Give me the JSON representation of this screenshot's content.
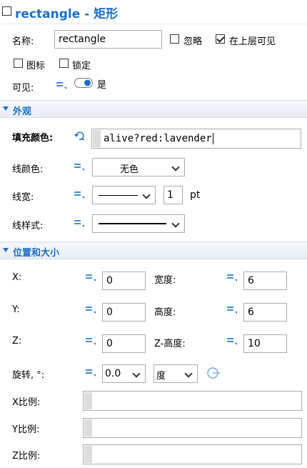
{
  "title": "rectangle - 矩形",
  "general": {
    "name_label": "名称:",
    "name_value": "rectangle",
    "ignore_label": "忽略",
    "ignore_checked": false,
    "show_on_top_label": "在上层可见",
    "show_on_top_checked": true,
    "icon_label": "图标",
    "icon_checked": false,
    "lock_label": "锁定",
    "lock_checked": false,
    "visible_label": "可见:",
    "visible_value": "是",
    "visible_on": true
  },
  "appearance": {
    "section_label": "外观",
    "fill_color_label": "填充颜色:",
    "fill_color_value": "alive?red:lavender",
    "line_color_label": "线颜色:",
    "line_color_value": "无色",
    "line_width_label": "线宽:",
    "line_width_value": "1",
    "line_width_unit": "pt",
    "line_style_label": "线样式:"
  },
  "position": {
    "section_label": "位置和大小",
    "x_label": "X:",
    "x_value": "0",
    "width_label": "宽度:",
    "width_value": "6",
    "y_label": "Y:",
    "y_value": "0",
    "height_label": "高度:",
    "height_value": "6",
    "z_label": "Z:",
    "z_value": "0",
    "z_height_label": "Z-高度:",
    "z_height_value": "10",
    "rotation_label": "旋转, °:",
    "rotation_value": "0.0",
    "rotation_unit": "度",
    "x_scale_label": "X比例:",
    "y_scale_label": "Y比例:",
    "z_scale_label": "Z比例:"
  },
  "colors": {
    "accent": "#1c6fc4",
    "section_bg": "#e9eff5"
  }
}
